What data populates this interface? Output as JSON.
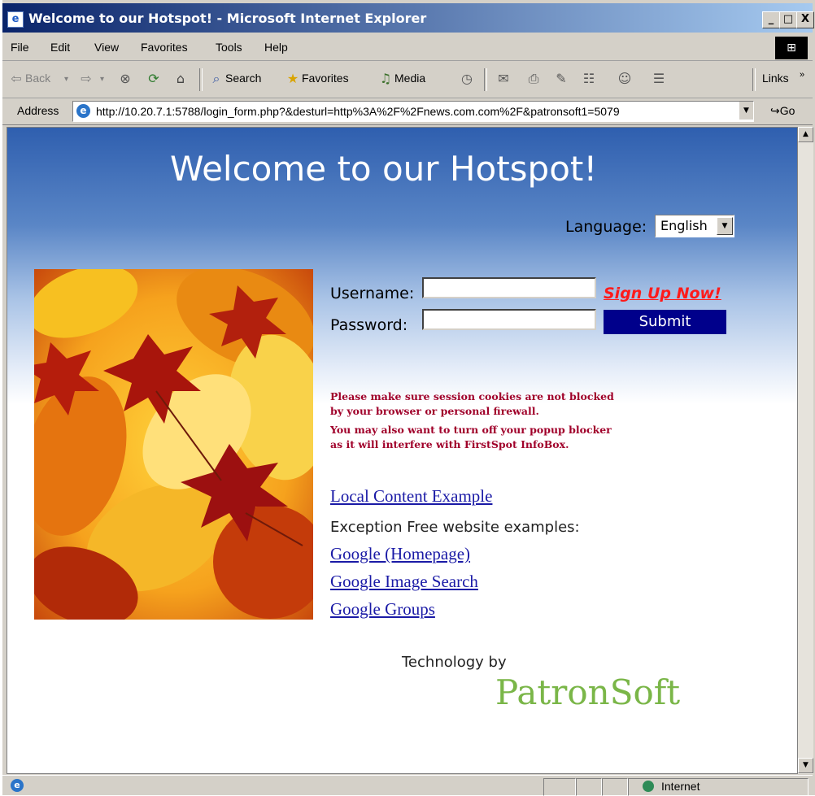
{
  "window": {
    "title": "Welcome to our Hotspot! - Microsoft Internet Explorer",
    "minimize": "_",
    "maximize": "□",
    "close": "X"
  },
  "menu": [
    "File",
    "Edit",
    "View",
    "Favorites",
    "Tools",
    "Help"
  ],
  "toolbar": {
    "back": "Back",
    "search": "Search",
    "favorites": "Favorites",
    "media": "Media",
    "links": "Links"
  },
  "address": {
    "label": "Address",
    "url": "http://10.20.7.1:5788/login_form.php?&desturl=http%3A%2F%2Fnews.com.com%2F&patronsoft1=5079",
    "go": "Go"
  },
  "page": {
    "title": "Welcome to our Hotspot!",
    "language_label": "Language:",
    "language_value": "English",
    "username_label": "Username:",
    "password_label": "Password:",
    "signup": "Sign Up Now!",
    "submit": "Submit",
    "warnings": [
      "Please make sure session cookies are not blocked",
      "by your browser or personal firewall.",
      "You may also want to turn off your popup blocker",
      "as it will interfere with FirstSpot InfoBox."
    ],
    "local_link": "Local Content Example",
    "exception_text": "Exception Free website examples:",
    "links": [
      "Google (Homepage)",
      "Google Image Search",
      "Google Groups"
    ],
    "technology_by": "Technology by",
    "brand": "PatronSoft"
  },
  "status": {
    "zone": "Internet"
  }
}
